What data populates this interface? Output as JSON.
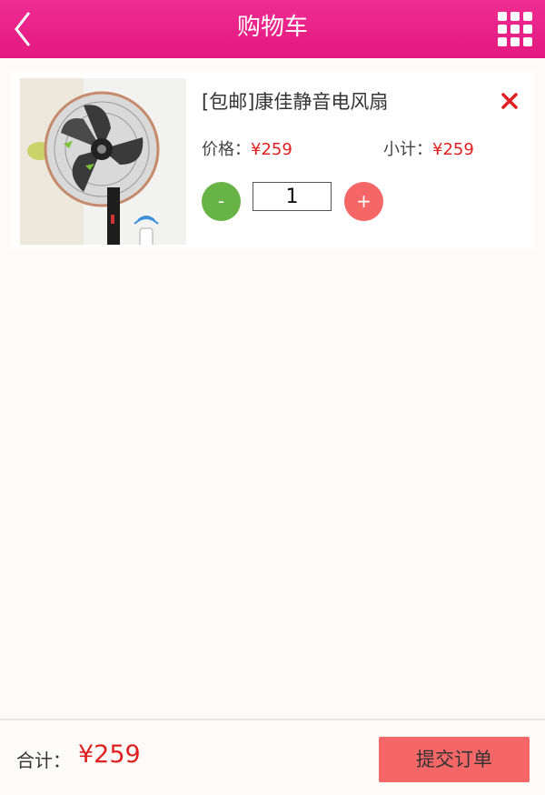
{
  "header": {
    "title": "购物车"
  },
  "cart": {
    "items": [
      {
        "name": "[包邮]康佳静音电风扇",
        "price_label": "价格：",
        "price": "¥259",
        "subtotal_label": "小计：",
        "subtotal": "¥259",
        "minus_label": "-",
        "quantity": "1",
        "plus_label": "+"
      }
    ]
  },
  "footer": {
    "total_label": "合计：",
    "total": "¥259",
    "submit_label": "提交订单"
  },
  "colors": {
    "header": "#e8208a",
    "price": "#e02020",
    "minus": "#67b346",
    "plus": "#f56666",
    "submit": "#f56666"
  }
}
